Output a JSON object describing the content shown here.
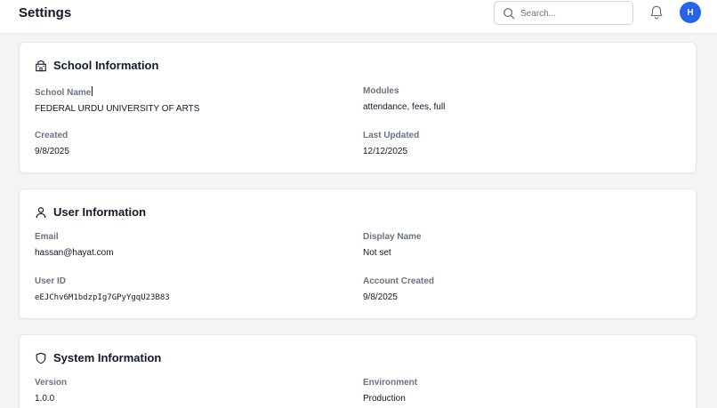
{
  "header": {
    "title": "Settings",
    "search_placeholder": "Search...",
    "search_icon": "search-icon",
    "bell_icon": "bell-icon",
    "avatar_initial": "H",
    "accent_color": "#2563eb"
  },
  "school": {
    "title": "School Information",
    "icon": "building-icon",
    "school_name_label": "School Name",
    "school_name_value": "FEDERAL URDU UNIVERSITY OF ARTS",
    "modules_label": "Modules",
    "modules_value": "attendance, fees, full",
    "created_label": "Created",
    "created_value": "9/8/2025",
    "updated_label": "Last Updated",
    "updated_value": "12/12/2025"
  },
  "user": {
    "title": "User Information",
    "icon": "user-icon",
    "email_label": "Email",
    "email_value": "hassan@hayat.com",
    "display_name_label": "Display Name",
    "display_name_value": "Not set",
    "user_id_label": "User ID",
    "user_id_value": "eEJChv6M1bdzpIg7GPyYgqU23B83",
    "account_created_label": "Account Created",
    "account_created_value": "9/8/2025"
  },
  "system": {
    "title": "System Information",
    "icon": "shield-icon",
    "version_label": "Version",
    "version_value": "1.0.0",
    "environment_label": "Environment",
    "environment_value": "Production"
  }
}
